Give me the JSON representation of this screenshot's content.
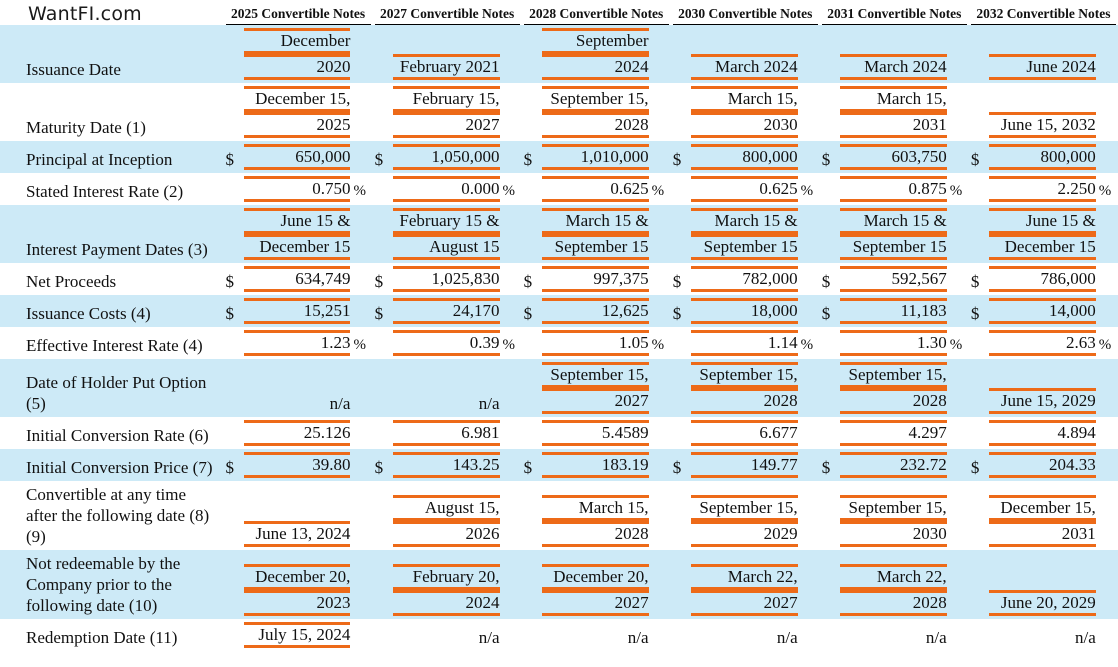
{
  "brand": "WantFI.com",
  "table": {
    "columns": [
      {
        "label": "2025 Convertible Notes"
      },
      {
        "label": "2027 Convertible Notes"
      },
      {
        "label": "2028 Convertible Notes"
      },
      {
        "label": "2030 Convertible Notes"
      },
      {
        "label": "2031 Convertible Notes"
      },
      {
        "label": "2032 Convertible Notes"
      }
    ],
    "rows": [
      {
        "label": "Issuance Date",
        "striped": true,
        "cells": [
          {
            "lines": [
              "December",
              "2020"
            ],
            "marked": true
          },
          {
            "lines": [
              "February 2021"
            ],
            "marked": true
          },
          {
            "lines": [
              "September",
              "2024"
            ],
            "marked": true
          },
          {
            "lines": [
              "March 2024"
            ],
            "marked": true
          },
          {
            "lines": [
              "March 2024"
            ],
            "marked": true
          },
          {
            "lines": [
              "June 2024"
            ],
            "marked": true
          }
        ]
      },
      {
        "label": "Maturity Date (1)",
        "striped": false,
        "cells": [
          {
            "lines": [
              "December 15,",
              "2025"
            ],
            "marked": true
          },
          {
            "lines": [
              "February 15,",
              "2027"
            ],
            "marked": true
          },
          {
            "lines": [
              "September 15,",
              "2028"
            ],
            "marked": true
          },
          {
            "lines": [
              "March 15,",
              "2030"
            ],
            "marked": true
          },
          {
            "lines": [
              "March 15,",
              "2031"
            ],
            "marked": true
          },
          {
            "lines": [
              "June 15, 2032"
            ],
            "marked": true
          }
        ]
      },
      {
        "label": "Principal at Inception",
        "striped": true,
        "prefix": "$",
        "cells": [
          {
            "lines": [
              "650,000"
            ],
            "marked": true
          },
          {
            "lines": [
              "1,050,000"
            ],
            "marked": true
          },
          {
            "lines": [
              "1,010,000"
            ],
            "marked": true
          },
          {
            "lines": [
              "800,000"
            ],
            "marked": true
          },
          {
            "lines": [
              "603,750"
            ],
            "marked": true
          },
          {
            "lines": [
              "800,000"
            ],
            "marked": true
          }
        ]
      },
      {
        "label": "Stated Interest Rate (2)",
        "striped": false,
        "suffix": "%",
        "cells": [
          {
            "lines": [
              "0.750"
            ],
            "marked": true
          },
          {
            "lines": [
              "0.000"
            ],
            "marked": true
          },
          {
            "lines": [
              "0.625"
            ],
            "marked": true
          },
          {
            "lines": [
              "0.625"
            ],
            "marked": true
          },
          {
            "lines": [
              "0.875"
            ],
            "marked": true
          },
          {
            "lines": [
              "2.250"
            ],
            "marked": true
          }
        ]
      },
      {
        "label": "Interest Payment Dates (3)",
        "striped": true,
        "cells": [
          {
            "lines": [
              "June 15 &",
              "December 15"
            ],
            "marked": true
          },
          {
            "lines": [
              "February 15 &",
              "August 15"
            ],
            "marked": true
          },
          {
            "lines": [
              "March 15 &",
              "September 15"
            ],
            "marked": true
          },
          {
            "lines": [
              "March 15 &",
              "September 15"
            ],
            "marked": true
          },
          {
            "lines": [
              "March 15 &",
              "September 15"
            ],
            "marked": true
          },
          {
            "lines": [
              "June 15 &",
              "December 15"
            ],
            "marked": true
          }
        ]
      },
      {
        "label": "Net Proceeds",
        "striped": false,
        "prefix": "$",
        "cells": [
          {
            "lines": [
              "634,749"
            ],
            "marked": true
          },
          {
            "lines": [
              "1,025,830"
            ],
            "marked": true
          },
          {
            "lines": [
              "997,375"
            ],
            "marked": true
          },
          {
            "lines": [
              "782,000"
            ],
            "marked": true
          },
          {
            "lines": [
              "592,567"
            ],
            "marked": true
          },
          {
            "lines": [
              "786,000"
            ],
            "marked": true
          }
        ]
      },
      {
        "label": "Issuance Costs (4)",
        "striped": true,
        "prefix": "$",
        "cells": [
          {
            "lines": [
              "15,251"
            ],
            "marked": true
          },
          {
            "lines": [
              "24,170"
            ],
            "marked": true
          },
          {
            "lines": [
              "12,625"
            ],
            "marked": true
          },
          {
            "lines": [
              "18,000"
            ],
            "marked": true
          },
          {
            "lines": [
              "11,183"
            ],
            "marked": true
          },
          {
            "lines": [
              "14,000"
            ],
            "marked": true
          }
        ]
      },
      {
        "label": "Effective Interest Rate (4)",
        "striped": false,
        "suffix": "%",
        "cells": [
          {
            "lines": [
              "1.23"
            ],
            "marked": true
          },
          {
            "lines": [
              "0.39"
            ],
            "marked": true
          },
          {
            "lines": [
              "1.05"
            ],
            "marked": true
          },
          {
            "lines": [
              "1.14"
            ],
            "marked": true
          },
          {
            "lines": [
              "1.30"
            ],
            "marked": true
          },
          {
            "lines": [
              "2.63"
            ],
            "marked": true
          }
        ]
      },
      {
        "label": "Date of Holder Put Option (5)",
        "striped": true,
        "cells": [
          {
            "lines": [
              "n/a"
            ],
            "marked": false
          },
          {
            "lines": [
              "n/a"
            ],
            "marked": false
          },
          {
            "lines": [
              "September 15,",
              "2027"
            ],
            "marked": true
          },
          {
            "lines": [
              "September 15,",
              "2028"
            ],
            "marked": true
          },
          {
            "lines": [
              "September 15,",
              "2028"
            ],
            "marked": true
          },
          {
            "lines": [
              "June 15, 2029"
            ],
            "marked": true
          }
        ]
      },
      {
        "label": "Initial Conversion Rate (6)",
        "striped": false,
        "cells": [
          {
            "lines": [
              "25.126"
            ],
            "marked": true
          },
          {
            "lines": [
              "6.981"
            ],
            "marked": true
          },
          {
            "lines": [
              "5.4589"
            ],
            "marked": true
          },
          {
            "lines": [
              "6.677"
            ],
            "marked": true
          },
          {
            "lines": [
              "4.297"
            ],
            "marked": true
          },
          {
            "lines": [
              "4.894"
            ],
            "marked": true
          }
        ]
      },
      {
        "label": "Initial Conversion Price (7)",
        "striped": true,
        "prefix": "$",
        "cells": [
          {
            "lines": [
              "39.80"
            ],
            "marked": true
          },
          {
            "lines": [
              "143.25"
            ],
            "marked": true
          },
          {
            "lines": [
              "183.19"
            ],
            "marked": true
          },
          {
            "lines": [
              "149.77"
            ],
            "marked": true
          },
          {
            "lines": [
              "232.72"
            ],
            "marked": true
          },
          {
            "lines": [
              "204.33"
            ],
            "marked": true
          }
        ]
      },
      {
        "label": "Convertible at any time after the following date (8) (9)",
        "striped": false,
        "cells": [
          {
            "lines": [
              "June 13, 2024"
            ],
            "marked": true
          },
          {
            "lines": [
              "August 15,",
              "2026"
            ],
            "marked": true
          },
          {
            "lines": [
              "March 15,",
              "2028"
            ],
            "marked": true
          },
          {
            "lines": [
              "September 15,",
              "2029"
            ],
            "marked": true
          },
          {
            "lines": [
              "September 15,",
              "2030"
            ],
            "marked": true
          },
          {
            "lines": [
              "December 15,",
              "2031"
            ],
            "marked": true
          }
        ]
      },
      {
        "label": "Not redeemable by the Company prior to the following date (10)",
        "striped": true,
        "cells": [
          {
            "lines": [
              "December 20,",
              "2023"
            ],
            "marked": true
          },
          {
            "lines": [
              "February 20,",
              "2024"
            ],
            "marked": true
          },
          {
            "lines": [
              "December 20,",
              "2027"
            ],
            "marked": true
          },
          {
            "lines": [
              "March 22,",
              "2027"
            ],
            "marked": true
          },
          {
            "lines": [
              "March 22,",
              "2028"
            ],
            "marked": true
          },
          {
            "lines": [
              "June 20, 2029"
            ],
            "marked": true
          }
        ]
      },
      {
        "label": "Redemption Date (11)",
        "striped": false,
        "cells": [
          {
            "lines": [
              "July 15, 2024"
            ],
            "marked": true
          },
          {
            "lines": [
              "n/a"
            ],
            "marked": false
          },
          {
            "lines": [
              "n/a"
            ],
            "marked": false
          },
          {
            "lines": [
              "n/a"
            ],
            "marked": false
          },
          {
            "lines": [
              "n/a"
            ],
            "marked": false
          },
          {
            "lines": [
              "n/a"
            ],
            "marked": false
          }
        ]
      }
    ]
  },
  "colors": {
    "highlight": "#ED6A18",
    "stripe": "#CDEAF7",
    "text": "#111111",
    "background": "#FFFFFF"
  }
}
